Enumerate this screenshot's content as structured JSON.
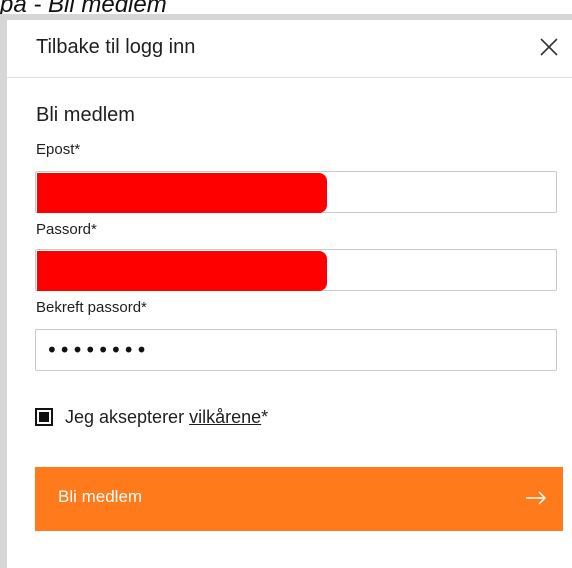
{
  "caption": "på - Bli medlem",
  "header": {
    "back_label": "Tilbake til logg inn",
    "close_icon": "close-icon"
  },
  "form": {
    "title": "Bli medlem",
    "email_label": "Epost*",
    "password_label": "Passord*",
    "confirm_label": "Bekreft passord*",
    "confirm_value": "••••••••",
    "terms_prefix": "Jeg aksepterer ",
    "terms_link": "vilkårene",
    "terms_suffix": "*",
    "terms_checked": true,
    "submit_label": "Bli medlem",
    "submit_icon": "arrow-right-icon"
  },
  "colors": {
    "accent": "#ff7a1a",
    "redaction": "#ff0000"
  }
}
